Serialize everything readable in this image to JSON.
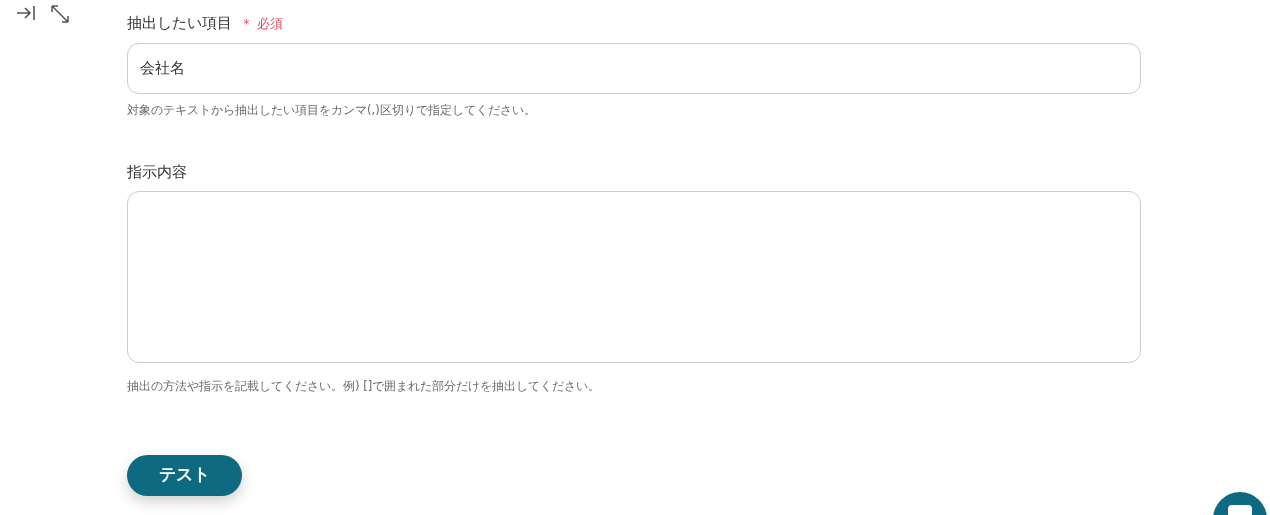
{
  "fields": [
    {
      "kind": "input",
      "label": "抽出したい項目",
      "required": true,
      "required_mark": "＊",
      "required_text": "必須",
      "value": "会社名",
      "help": "対象のテキストから抽出したい項目をカンマ(,)区切りで指定してください。"
    },
    {
      "kind": "textarea",
      "label": "指示内容",
      "required": false,
      "help": "抽出の方法や指示を記載してください。例) []で囲まれた部分だけを抽出してください。"
    }
  ],
  "test_button": {
    "label": "テスト"
  }
}
